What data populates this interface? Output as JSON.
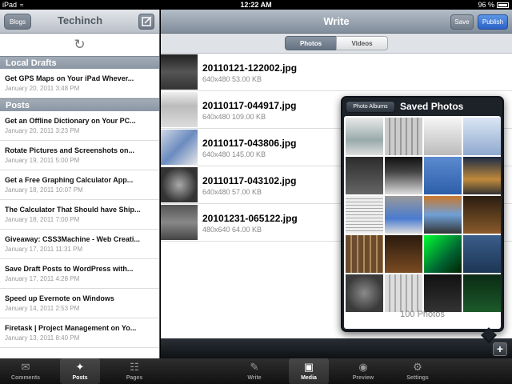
{
  "status_bar": {
    "carrier": "iPad",
    "time": "12:22 AM",
    "battery": "96 %"
  },
  "left_panel": {
    "back_button": "Blogs",
    "title": "Techinch",
    "local_drafts_header": "Local Drafts",
    "local_drafts": [
      {
        "title": "Get GPS Maps on Your iPad Whever...",
        "date": "January 20, 2011 3:48 PM"
      }
    ],
    "posts_header": "Posts",
    "posts": [
      {
        "title": "Get an Offline Dictionary on Your PC...",
        "date": "January 20, 2011 3:23 PM"
      },
      {
        "title": "Rotate Pictures and Screenshots on...",
        "date": "January 19, 2011 5:00 PM"
      },
      {
        "title": "Get a Free Graphing Calculator App...",
        "date": "January 18, 2011 10:07 PM"
      },
      {
        "title": "The Calculator That Should have Ship...",
        "date": "January 18, 2011 7:00 PM"
      },
      {
        "title": "Giveaway: CSS3Machine - Web Creati...",
        "date": "January 17, 2011 11:31 PM"
      },
      {
        "title": "Save Draft Posts to WordPress with...",
        "date": "January 17, 2011 4:28 PM"
      },
      {
        "title": "Speed up Evernote on Windows",
        "date": "January 14, 2011 2:53 PM"
      },
      {
        "title": "Firetask | Project Management on Yo...",
        "date": "January 13, 2011 8:40 PM"
      }
    ]
  },
  "right_panel": {
    "title": "Write",
    "save_label": "Save",
    "publish_label": "Publish",
    "segments": [
      "Photos",
      "Videos"
    ],
    "media": [
      {
        "name": "20110121-122002.jpg",
        "info": "640x480 53.00 KB"
      },
      {
        "name": "20110117-044917.jpg",
        "info": "640x480 109.00 KB"
      },
      {
        "name": "20110117-043806.jpg",
        "info": "640x480 145.00 KB"
      },
      {
        "name": "20110117-043102.jpg",
        "info": "640x480 57.00 KB"
      },
      {
        "name": "20101231-065122.jpg",
        "info": "480x640 64.00 KB"
      }
    ]
  },
  "popover": {
    "back_label": "Photo Albums",
    "title": "Saved Photos",
    "count_label": "100 Photos"
  },
  "tabs": [
    {
      "label": "Comments",
      "icon": "speech-bubble-icon",
      "active": false
    },
    {
      "label": "Posts",
      "icon": "pushpin-icon",
      "active": true
    },
    {
      "label": "Pages",
      "icon": "pages-icon",
      "active": false
    },
    {
      "label": "Write",
      "icon": "pencil-icon",
      "active": false
    },
    {
      "label": "Media",
      "icon": "photo-icon",
      "active": true
    },
    {
      "label": "Preview",
      "icon": "eye-icon",
      "active": false
    },
    {
      "label": "Settings",
      "icon": "gear-icon",
      "active": false
    }
  ]
}
